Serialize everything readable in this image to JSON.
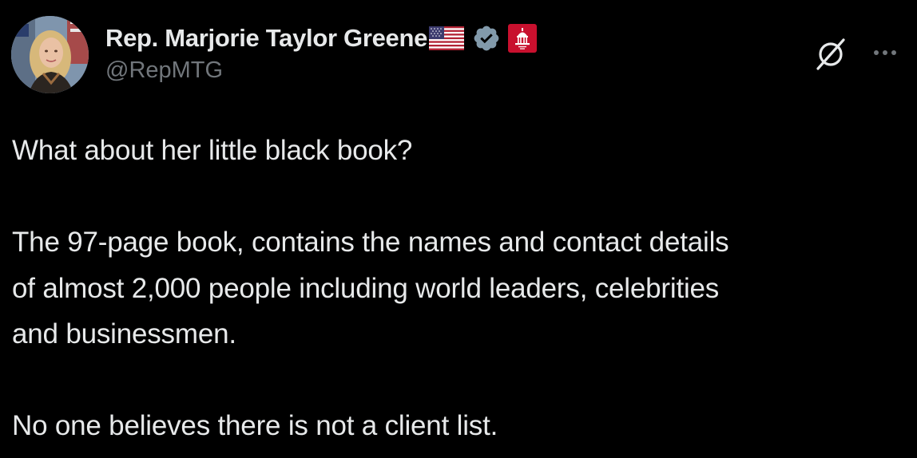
{
  "author": {
    "display_name": "Rep. Marjorie Taylor Greene",
    "handle": "@RepMTG",
    "flag_icon": "us-flag-icon",
    "verified_icon": "verified-badge-icon",
    "verified_color": "#829aab",
    "affiliation_icon": "us-capitol-badge-icon",
    "affiliation_color": "#c8102e"
  },
  "actions": {
    "grok_icon": "grok-icon",
    "more_icon": "more-options-icon"
  },
  "tweet": {
    "line_1": "What about her little black book?",
    "line_2": "The 97-page book, contains the names and contact details",
    "line_3": "of almost 2,000 people including world leaders, celebrities",
    "line_4": "and businessmen.",
    "line_5": "No one believes there is not a client list."
  },
  "colors": {
    "background": "#000000",
    "text_primary": "#e7e9ea",
    "text_secondary": "#71767b"
  }
}
